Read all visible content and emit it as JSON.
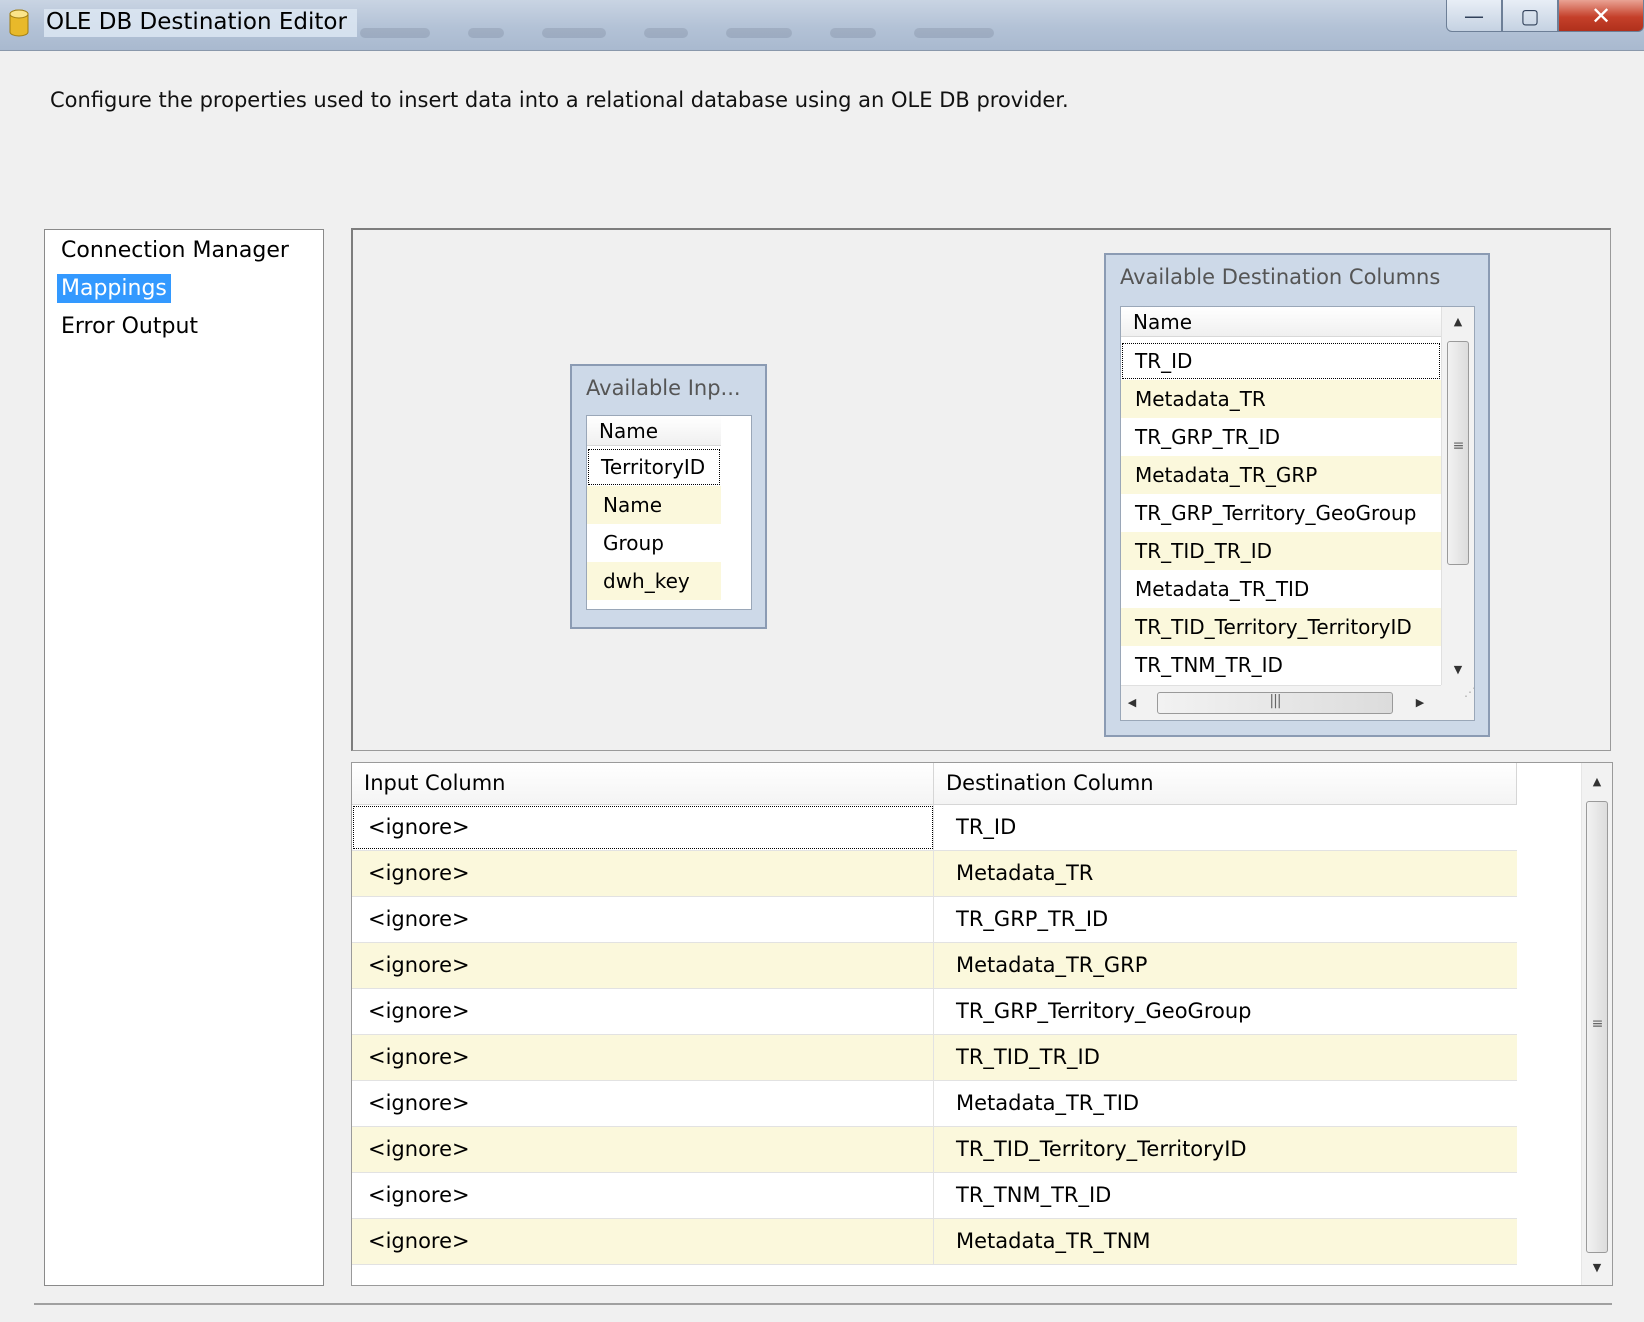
{
  "window": {
    "title": "OLE DB Destination Editor",
    "controls": {
      "minimize": "—",
      "maximize": "▢",
      "close": "✕"
    }
  },
  "description": "Configure the properties used to insert data into a relational database using an OLE DB provider.",
  "nav": {
    "items": [
      {
        "label": "Connection Manager"
      },
      {
        "label": "Mappings",
        "selected": true
      },
      {
        "label": "Error Output"
      }
    ]
  },
  "input_box": {
    "title": "Available Inp...",
    "header": "Name",
    "rows": [
      "TerritoryID",
      "Name",
      "Group",
      "dwh_key"
    ]
  },
  "dest_box": {
    "title": "Available Destination Columns",
    "header": "Name",
    "rows": [
      "TR_ID",
      "Metadata_TR",
      "TR_GRP_TR_ID",
      "Metadata_TR_GRP",
      "TR_GRP_Territory_GeoGroup",
      "TR_TID_TR_ID",
      "Metadata_TR_TID",
      "TR_TID_Territory_TerritoryID",
      "TR_TNM_TR_ID"
    ]
  },
  "grid": {
    "headers": {
      "input": "Input Column",
      "destination": "Destination Column"
    },
    "rows": [
      {
        "input": "<ignore>",
        "destination": "TR_ID"
      },
      {
        "input": "<ignore>",
        "destination": "Metadata_TR"
      },
      {
        "input": "<ignore>",
        "destination": "TR_GRP_TR_ID"
      },
      {
        "input": "<ignore>",
        "destination": "Metadata_TR_GRP"
      },
      {
        "input": "<ignore>",
        "destination": "TR_GRP_Territory_GeoGroup"
      },
      {
        "input": "<ignore>",
        "destination": "TR_TID_TR_ID"
      },
      {
        "input": "<ignore>",
        "destination": "Metadata_TR_TID"
      },
      {
        "input": "<ignore>",
        "destination": "TR_TID_Territory_TerritoryID"
      },
      {
        "input": "<ignore>",
        "destination": "TR_TNM_TR_ID"
      },
      {
        "input": "<ignore>",
        "destination": "Metadata_TR_TNM"
      }
    ]
  },
  "colors": {
    "selection": "#3399ff",
    "alt_row": "#fbf8dc",
    "box_background": "#cdd9e8",
    "close_button": "#c5402a"
  },
  "icons": {
    "app": "database-cylinder-icon",
    "scroll_up": "arrow-up-icon",
    "scroll_down": "arrow-down-icon",
    "scroll_left": "arrow-left-icon",
    "scroll_right": "arrow-right-icon"
  }
}
